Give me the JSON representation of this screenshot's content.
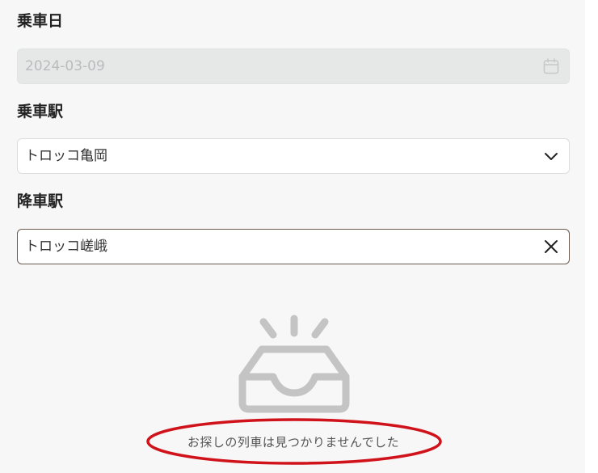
{
  "form": {
    "ride_date": {
      "label": "乗車日",
      "value": "2024-03-09",
      "icon": "calendar-icon"
    },
    "boarding_station": {
      "label": "乗車駅",
      "value": "トロッコ亀岡",
      "icon": "chevron-down-icon"
    },
    "alighting_station": {
      "label": "降車駅",
      "value": "トロッコ嵯峨",
      "icon": "close-icon"
    }
  },
  "empty_state": {
    "icon": "empty-inbox-icon",
    "message": "お探しの列車は見つかりませんでした"
  },
  "colors": {
    "panel_background": "#f7f7f7",
    "disabled_field": "#e6e8e8",
    "focused_border": "#6b5a4f",
    "empty_icon": "#c4c4c4",
    "highlight": "#d0121b"
  }
}
